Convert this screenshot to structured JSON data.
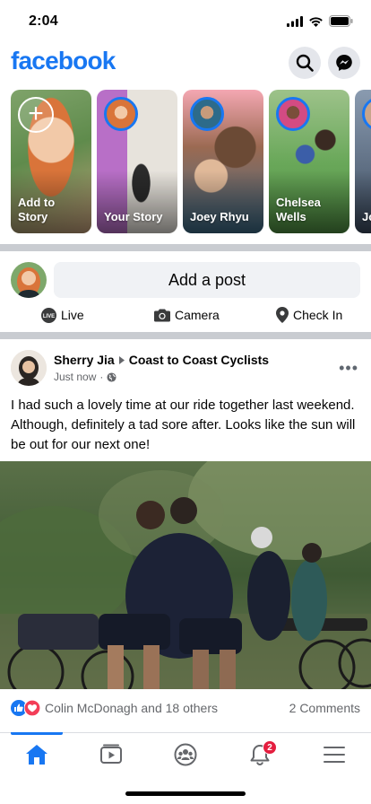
{
  "status_bar": {
    "time": "2:04"
  },
  "header": {
    "logo": "facebook",
    "search_icon": "search-icon",
    "messenger_icon": "messenger-icon"
  },
  "stories": [
    {
      "label": "Add to Story",
      "type": "add"
    },
    {
      "label": "Your Story",
      "type": "story"
    },
    {
      "label": "Joey Rhyu",
      "type": "story"
    },
    {
      "label": "Chelsea Wells",
      "type": "story"
    },
    {
      "label": "Jo La",
      "type": "story"
    }
  ],
  "composer": {
    "placeholder": "Add a post",
    "actions": [
      {
        "label": "Live",
        "icon": "live-icon"
      },
      {
        "label": "Camera",
        "icon": "camera-icon"
      },
      {
        "label": "Check In",
        "icon": "location-pin-icon"
      }
    ]
  },
  "post": {
    "author": "Sherry Jia",
    "group": "Coast to Coast Cyclists",
    "time": "Just now",
    "privacy_icon": "globe-icon",
    "text": "I had such a lovely time at our ride together last weekend. Although, definitely a tad sore after. Looks like the sun will be out for our next one!",
    "reactions_text": "Colin McDonagh and 18 others",
    "comments_text": "2 Comments",
    "reaction_icons": [
      "like-icon",
      "love-icon"
    ]
  },
  "bottom_nav": {
    "items": [
      "home-icon",
      "watch-icon",
      "groups-icon",
      "notifications-icon",
      "menu-icon"
    ],
    "notifications_badge": "2"
  },
  "colors": {
    "brand": "#1877f2",
    "badge": "#e41e3f",
    "love": "#f33e58"
  }
}
